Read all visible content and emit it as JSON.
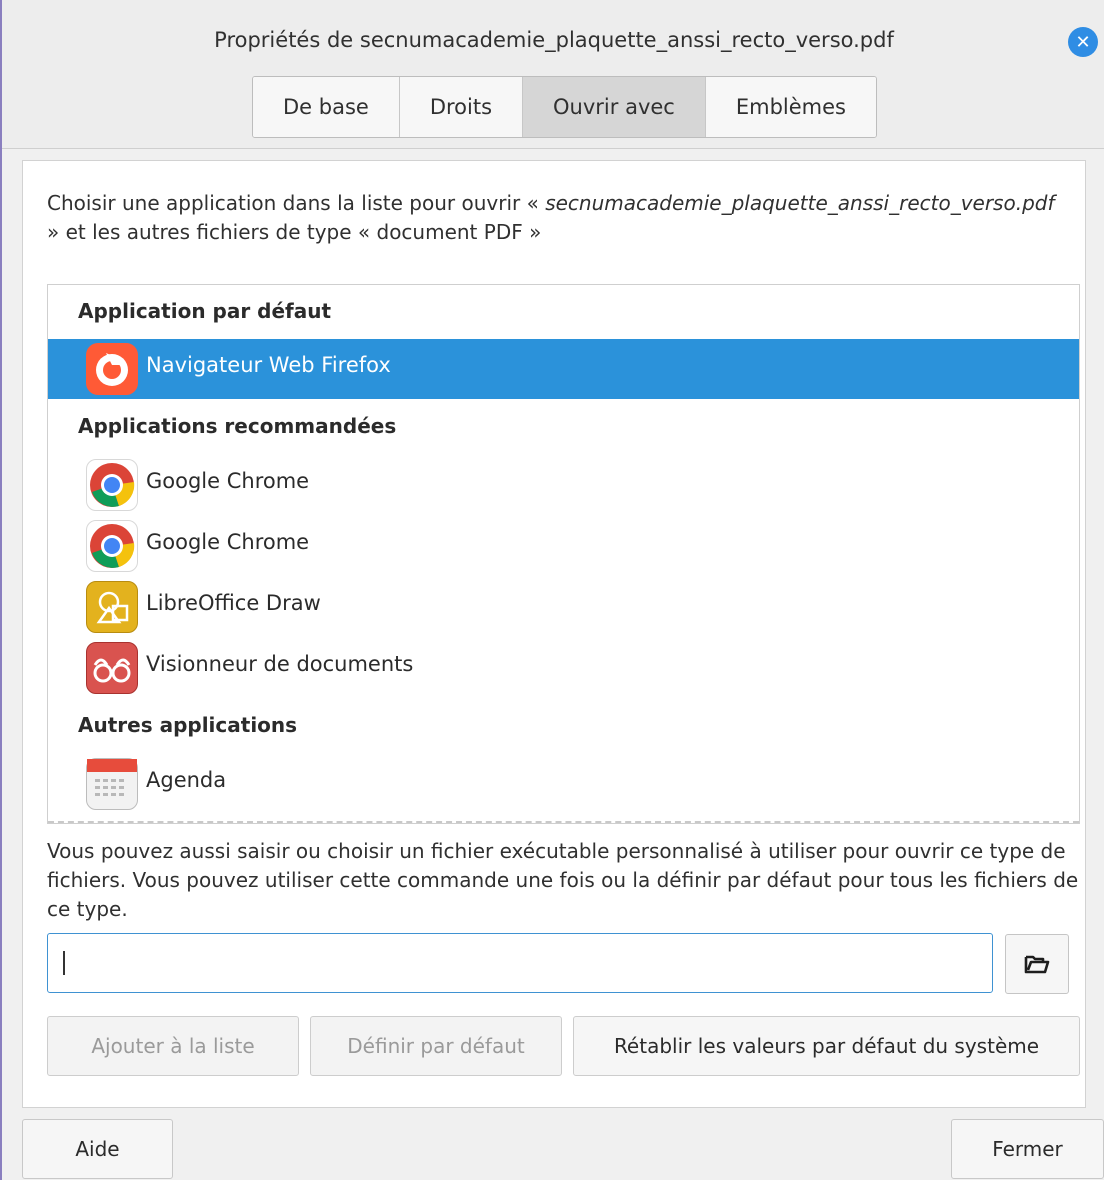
{
  "window": {
    "title": "Propriétés de secnumacademie_plaquette_anssi_recto_verso.pdf",
    "close_symbol": "✕"
  },
  "tabs": [
    {
      "label": "De base",
      "active": false
    },
    {
      "label": "Droits",
      "active": false
    },
    {
      "label": "Ouvrir avec",
      "active": true
    },
    {
      "label": "Emblèmes",
      "active": false
    }
  ],
  "intro": {
    "prefix": "Choisir une application dans la liste pour ouvrir « ",
    "filename": "secnumacademie_plaquette_anssi_recto_verso.pdf",
    "suffix": " » et les autres fichiers de type « document PDF »"
  },
  "app_list": {
    "default_header": "Application par défaut",
    "recommended_header": "Applications recommandées",
    "other_header": "Autres applications",
    "default_app": {
      "label": "Navigateur Web Firefox",
      "icon": "firefox-icon",
      "selected": true
    },
    "recommended": [
      {
        "label": "Google Chrome",
        "icon": "chrome-icon"
      },
      {
        "label": "Google Chrome",
        "icon": "chrome-icon"
      },
      {
        "label": "LibreOffice Draw",
        "icon": "libreoffice-draw-icon"
      },
      {
        "label": "Visionneur de documents",
        "icon": "document-viewer-icon"
      }
    ],
    "other": [
      {
        "label": "Agenda",
        "icon": "calendar-icon"
      }
    ]
  },
  "custom_command": {
    "description": "Vous pouvez aussi saisir ou choisir un fichier exécutable personnalisé à utiliser pour ouvrir ce type de fichiers. Vous pouvez utiliser cette commande une fois ou la définir par défaut pour tous les fichiers de ce type.",
    "value": "",
    "browse_icon": "folder-open-icon"
  },
  "actions": {
    "add_to_list": "Ajouter à la liste",
    "set_default": "Définir par défaut",
    "reset_defaults": "Rétablir les valeurs par défaut du système"
  },
  "footer": {
    "help": "Aide",
    "close": "Fermer"
  },
  "colors": {
    "selection": "#2b92da",
    "accent": "#2f8de4"
  }
}
